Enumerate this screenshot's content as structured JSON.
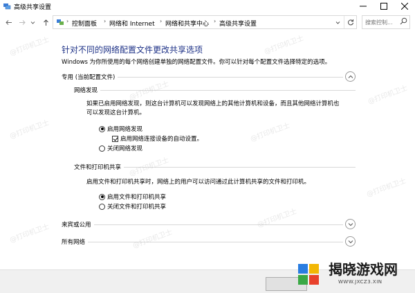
{
  "window": {
    "title": "高级共享设置"
  },
  "address": {
    "breadcrumbs": [
      "控制面板",
      "网络和 Internet",
      "网络和共享中心",
      "高级共享设置"
    ]
  },
  "search": {
    "placeholder": "搜索控制..."
  },
  "page": {
    "heading": "针对不同的网络配置文件更改共享选项",
    "description": "Windows 为你所使用的每个网络创建单独的网络配置文件。你可以针对每个配置文件选择特定的选项。"
  },
  "profiles": {
    "private": {
      "label": "专用 (当前配置文件)",
      "expanded": true,
      "discovery": {
        "title": "网络发现",
        "description_line1": "如果已启用网络发现，则这台计算机可以发现网络上的其他计算机和设备，而且其他网络计算机也",
        "description_line2": "可以发现这台计算机。",
        "option_on": "启用网络发现",
        "option_auto": "启用网络连接设备的自动设置。",
        "option_off": "关闭网络发现",
        "selected": "on",
        "auto_setup_checked": true
      },
      "sharing": {
        "title": "文件和打印机共享",
        "description": "启用文件和打印机共享时，网络上的用户可以访问通过此计算机共享的文件和打印机。",
        "option_on": "启用文件和打印机共享",
        "option_off": "关闭文件和打印机共享",
        "selected": "on"
      }
    },
    "guest": {
      "label": "来宾或公用",
      "expanded": false
    },
    "all": {
      "label": "所有网络",
      "expanded": false
    }
  },
  "watermark": {
    "text": "@打印机卫士"
  },
  "logo": {
    "name": "揭晓游戏网",
    "url": "WWW.JXCZ3.XIN"
  }
}
